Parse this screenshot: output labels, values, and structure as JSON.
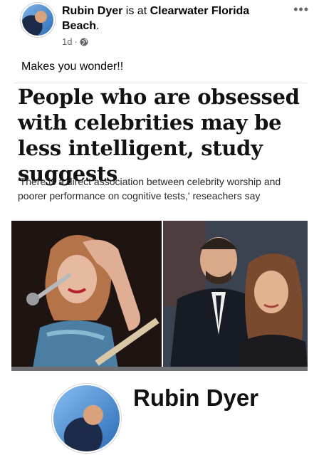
{
  "post": {
    "author": "Rubin Dyer",
    "activity": "is at",
    "location": "Clearwater Florida Beach",
    "location_end": ".",
    "time": "1d",
    "separator": "·",
    "audience_icon": "globe-icon",
    "more_icon": "more-options-icon",
    "more_glyph": "•••",
    "caption": "Makes you wonder!!"
  },
  "article": {
    "headline": "People who are obsessed with celebrities may be less intelligent, study suggests",
    "standfirst": "'There is a direct association between celebrity worship and poorer performance on cognitive tests,' reseachers say"
  },
  "footer": {
    "name": "Rubin Dyer"
  },
  "colors": {
    "text": "#050505",
    "meta": "#65676b",
    "divider": "#e4e6eb"
  }
}
